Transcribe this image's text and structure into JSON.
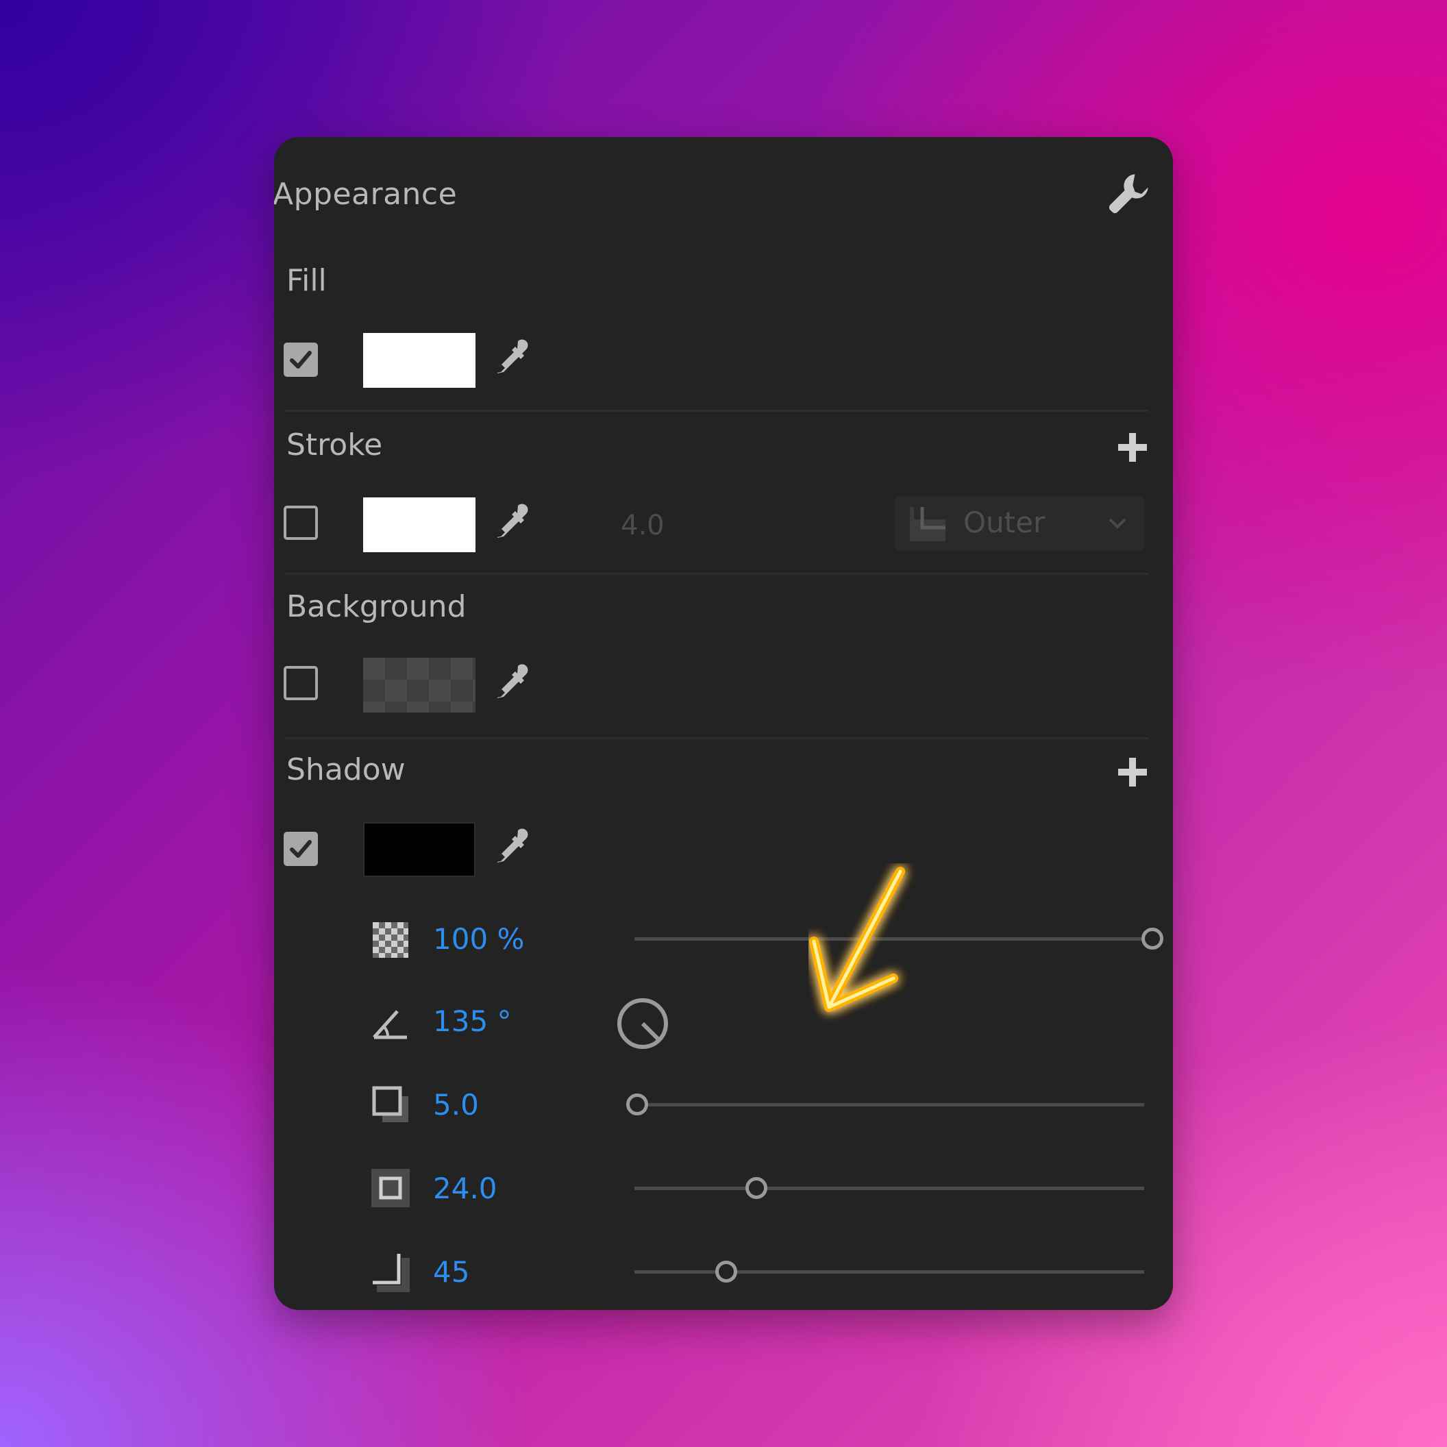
{
  "panel": {
    "title": "Appearance",
    "settings_icon": "wrench-icon"
  },
  "fill": {
    "label": "Fill",
    "enabled": true,
    "color": "#ffffff"
  },
  "stroke": {
    "label": "Stroke",
    "enabled": false,
    "color": "#ffffff",
    "width": "4.0",
    "position": "Outer",
    "add_icon": "plus-icon"
  },
  "background": {
    "label": "Background",
    "enabled": false,
    "color": "#4a4a4a"
  },
  "shadow": {
    "label": "Shadow",
    "enabled": true,
    "color": "#000000",
    "add_icon": "plus-icon",
    "opacity": {
      "value": "100 %",
      "level": 1.0,
      "icon": "opacity-checker-icon"
    },
    "angle": {
      "value": "135 °",
      "icon": "angle-icon"
    },
    "distance": {
      "value": "5.0",
      "level": 0.0,
      "icon": "distance-icon"
    },
    "size": {
      "value": "24.0",
      "level": 0.24,
      "icon": "size-icon"
    },
    "blur": {
      "value": "45",
      "level": 0.18,
      "icon": "blur-icon"
    }
  },
  "annotation": {
    "arrow_color": "#ffc21a",
    "icon": "neon-arrow-icon"
  }
}
